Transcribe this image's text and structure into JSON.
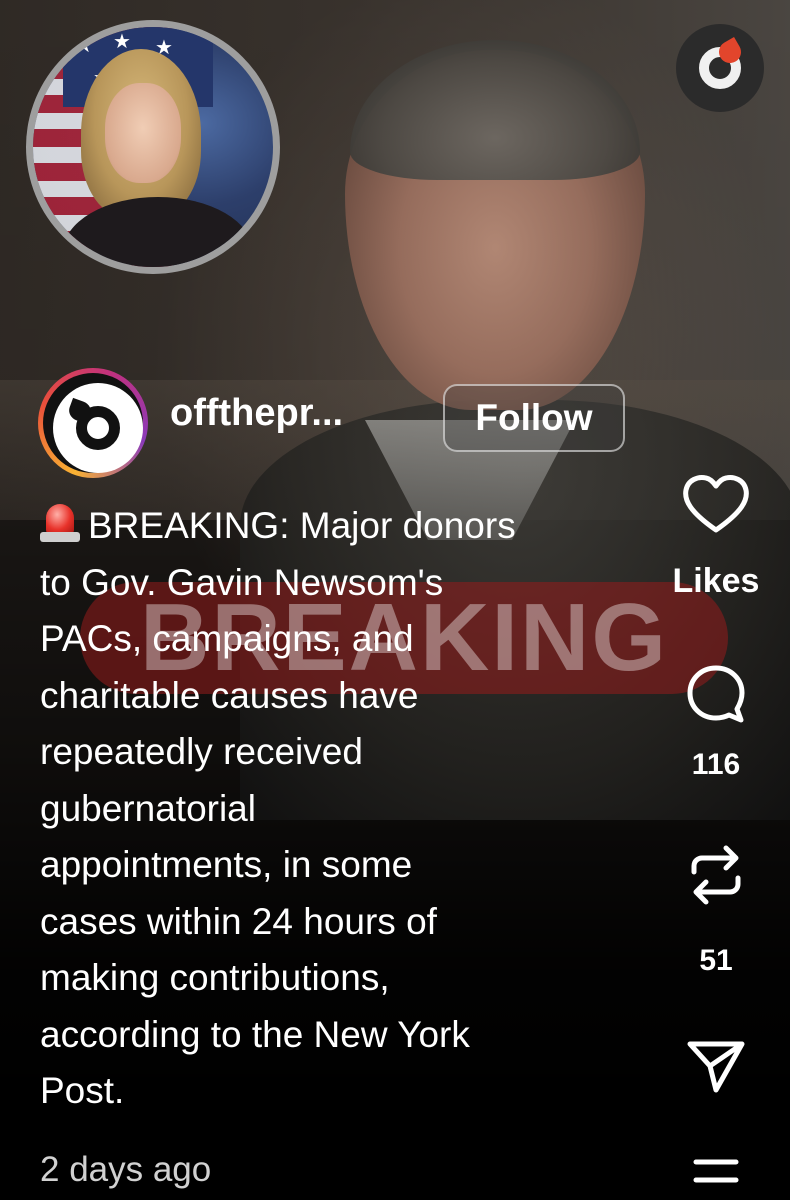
{
  "banner_background_text": "BREAKING",
  "account": {
    "username": "offthepr...",
    "follow_label": "Follow"
  },
  "caption": {
    "lines": [
      "BREAKING: Major donors",
      "to Gov. Gavin Newsom's",
      "PACs, campaigns, and",
      "charitable causes have",
      "repeatedly received",
      "gubernatorial",
      "appointments, in some",
      "cases within 24 hours of",
      "making contributions,",
      "according to the New York",
      "Post."
    ],
    "leading_icon": "rotating-light-siren-emoji"
  },
  "timestamp": "2 days ago",
  "actions": {
    "like": {
      "icon": "heart-icon",
      "label": "Likes"
    },
    "comment": {
      "icon": "comment-bubble-icon",
      "count": "116"
    },
    "repost": {
      "icon": "repost-arrows-icon",
      "count": "51"
    },
    "share": {
      "icon": "paper-plane-icon"
    },
    "more": {
      "icon": "menu-lines-icon"
    }
  },
  "colors": {
    "background": "#000000",
    "text": "#ffffff",
    "banner_red": "#961c1c",
    "brand_flame": "#e2452c"
  }
}
